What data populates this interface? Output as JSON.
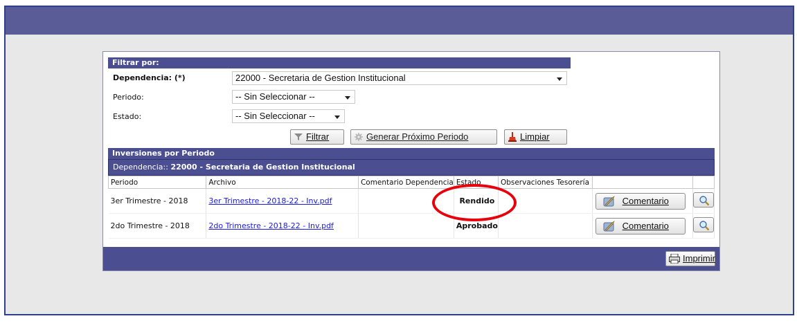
{
  "filter": {
    "header": "Filtrar por:",
    "dependencia_label": "Dependencia: (*)",
    "dependencia_value": "22000 - Secretaria de Gestion Institucional",
    "periodo_label": "Periodo:",
    "periodo_value": "-- Sin Seleccionar --",
    "estado_label": "Estado:",
    "estado_value": "-- Sin Seleccionar --",
    "filtrar_label": "Filtrar",
    "generar_label": "Generar Próximo Periodo",
    "limpiar_label": "Limpiar"
  },
  "inversiones": {
    "header": "Inversiones por Periodo",
    "dependencia_prefix": "Dependencia:: ",
    "dependencia_value": "22000 - Secretaria de Gestion Institucional",
    "columns": [
      "Periodo",
      "Archivo",
      "Comentario Dependencia",
      "Estado",
      "Observaciones Tesorería"
    ],
    "rows": [
      {
        "periodo": "3er Trimestre - 2018",
        "archivo": "3er Trimestre - 2018-22 - Inv.pdf",
        "comentario": "",
        "estado": "Rendido",
        "observaciones": "",
        "comentario_btn": "Comentario"
      },
      {
        "periodo": "2do Trimestre - 2018",
        "archivo": "2do Trimestre - 2018-22 - Inv.pdf",
        "comentario": "",
        "estado": "Aprobado",
        "observaciones": "",
        "comentario_btn": "Comentario"
      }
    ]
  },
  "footer": {
    "imprimir_label": "Imprimir"
  },
  "colors": {
    "header_blue": "#4b4f92",
    "estado_red": "#c00000",
    "highlight_red": "#e8000b",
    "link_blue": "#1a1ae0"
  }
}
